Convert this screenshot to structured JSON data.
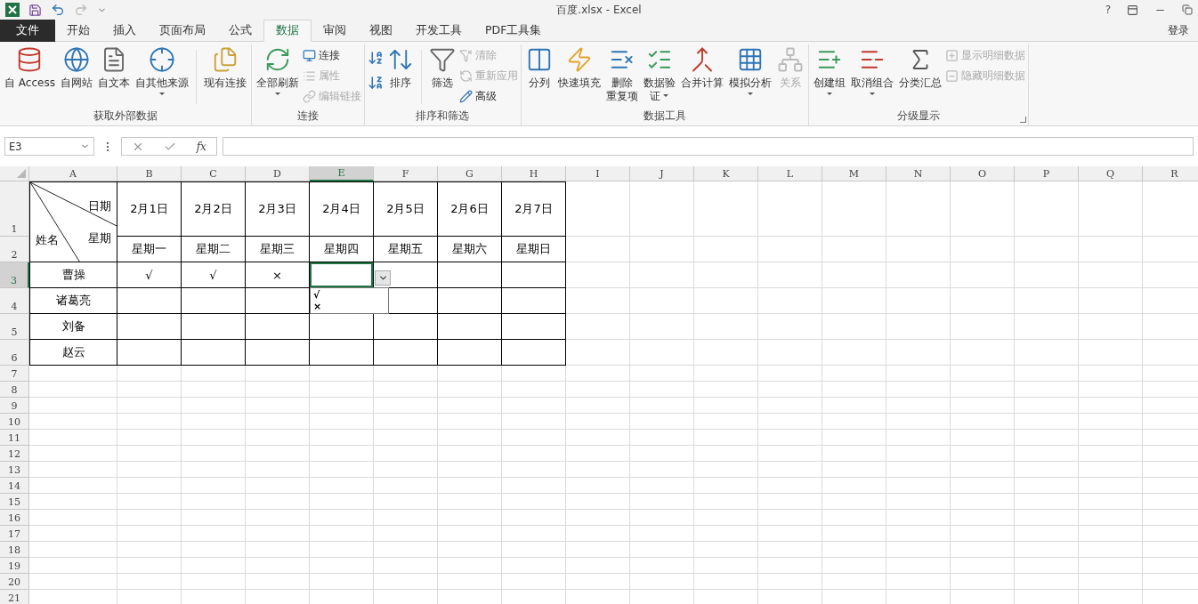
{
  "window": {
    "title": "百度.xlsx - Excel",
    "help": "?"
  },
  "tabs": [
    {
      "label": "文件",
      "kind": "file",
      "selected": false
    },
    {
      "label": "开始",
      "kind": "tab",
      "selected": false
    },
    {
      "label": "插入",
      "kind": "tab",
      "selected": false
    },
    {
      "label": "页面布局",
      "kind": "tab",
      "selected": false
    },
    {
      "label": "公式",
      "kind": "tab",
      "selected": false
    },
    {
      "label": "数据",
      "kind": "tab",
      "selected": true
    },
    {
      "label": "审阅",
      "kind": "tab",
      "selected": false
    },
    {
      "label": "视图",
      "kind": "tab",
      "selected": false
    },
    {
      "label": "开发工具",
      "kind": "tab",
      "selected": false
    },
    {
      "label": "PDF工具集",
      "kind": "tab",
      "selected": false
    }
  ],
  "sign_in": "登录",
  "ribbon": {
    "groups": [
      {
        "label": "获取外部数据",
        "items": [
          {
            "kind": "large",
            "label": "自 Access",
            "disabled": false,
            "dropdown": false
          },
          {
            "kind": "large",
            "label": "自网站",
            "disabled": false,
            "dropdown": false
          },
          {
            "kind": "large",
            "label": "自文本",
            "disabled": false,
            "dropdown": false
          },
          {
            "kind": "large",
            "label": "自其他来源",
            "disabled": false,
            "dropdown": true
          },
          {
            "kind": "separator"
          },
          {
            "kind": "large",
            "label": "现有连接",
            "disabled": false,
            "dropdown": false
          }
        ]
      },
      {
        "label": "连接",
        "items": [
          {
            "kind": "large",
            "label": "全部刷新",
            "disabled": false,
            "dropdown": true
          },
          {
            "kind": "stack",
            "buttons": [
              {
                "label": "连接",
                "disabled": false
              },
              {
                "label": "属性",
                "disabled": true
              },
              {
                "label": "编辑链接",
                "disabled": true
              }
            ]
          }
        ]
      },
      {
        "label": "排序和筛选",
        "items": [
          {
            "kind": "sort-pair"
          },
          {
            "kind": "large",
            "label": "排序",
            "disabled": false,
            "dropdown": false
          },
          {
            "kind": "separator"
          },
          {
            "kind": "large",
            "label": "筛选",
            "disabled": false,
            "dropdown": false
          },
          {
            "kind": "stack",
            "buttons": [
              {
                "label": "清除",
                "disabled": true
              },
              {
                "label": "重新应用",
                "disabled": true
              },
              {
                "label": "高级",
                "disabled": false
              }
            ]
          }
        ]
      },
      {
        "label": "数据工具",
        "items": [
          {
            "kind": "large",
            "label": "分列",
            "disabled": false,
            "dropdown": false
          },
          {
            "kind": "large",
            "label": "快速填充",
            "disabled": false,
            "dropdown": false
          },
          {
            "kind": "large",
            "label_lines": [
              "删除",
              "重复项"
            ],
            "disabled": false,
            "dropdown": false
          },
          {
            "kind": "large",
            "label_lines": [
              "数据验",
              "证"
            ],
            "disabled": false,
            "dropdown": true
          },
          {
            "kind": "large",
            "label": "合并计算",
            "disabled": false,
            "dropdown": false
          },
          {
            "kind": "large",
            "label": "模拟分析",
            "disabled": false,
            "dropdown": true
          },
          {
            "kind": "large",
            "label": "关系",
            "disabled": true,
            "dropdown": false
          }
        ]
      },
      {
        "label": "分级显示",
        "launcher": true,
        "items": [
          {
            "kind": "large",
            "label": "创建组",
            "disabled": false,
            "dropdown": true
          },
          {
            "kind": "large",
            "label": "取消组合",
            "disabled": false,
            "dropdown": true
          },
          {
            "kind": "large",
            "label": "分类汇总",
            "disabled": false,
            "dropdown": false
          },
          {
            "kind": "stack",
            "buttons": [
              {
                "label": "显示明细数据",
                "disabled": true
              },
              {
                "label": "隐藏明细数据",
                "disabled": true
              }
            ]
          }
        ]
      }
    ]
  },
  "formula_bar": {
    "name_box": "E3",
    "function_button": "fx"
  },
  "sheet": {
    "columns": [
      {
        "label": "A",
        "selected": false
      },
      {
        "label": "B",
        "selected": false
      },
      {
        "label": "C",
        "selected": false
      },
      {
        "label": "D",
        "selected": false
      },
      {
        "label": "E",
        "selected": true
      },
      {
        "label": "F",
        "selected": false
      },
      {
        "label": "G",
        "selected": false
      },
      {
        "label": "H",
        "selected": false
      },
      {
        "label": "I",
        "selected": false
      },
      {
        "label": "J",
        "selected": false
      },
      {
        "label": "K",
        "selected": false
      },
      {
        "label": "L",
        "selected": false
      },
      {
        "label": "M",
        "selected": false
      },
      {
        "label": "N",
        "selected": false
      },
      {
        "label": "O",
        "selected": false
      },
      {
        "label": "P",
        "selected": false
      },
      {
        "label": "Q",
        "selected": false
      },
      {
        "label": "R",
        "selected": false
      }
    ],
    "rows": [
      {
        "number": "1",
        "selected": false,
        "bordered": true,
        "cells": [
          {
            "kind": "diagonal-header",
            "top_right": "日期",
            "bottom_right": "星期",
            "bottom_left": "姓名"
          },
          "2月1日",
          "2月2日",
          "2月3日",
          "2月4日",
          "2月5日",
          "2月6日",
          "2月7日"
        ]
      },
      {
        "number": "2",
        "selected": false,
        "bordered": true,
        "cells": [
          "",
          "星期一",
          "星期二",
          "星期三",
          "星期四",
          "星期五",
          "星期六",
          "星期日"
        ]
      },
      {
        "number": "3",
        "selected": true,
        "bordered": true,
        "cells": [
          "曹操",
          "√",
          "√",
          "×",
          {
            "validation_list": {
              "open": true,
              "options": [
                "√",
                "×"
              ]
            }
          }
        ]
      },
      {
        "number": "4",
        "selected": false,
        "bordered": true,
        "cells": [
          "诸葛亮"
        ]
      },
      {
        "number": "5",
        "selected": false,
        "bordered": true,
        "cells": [
          "刘备"
        ]
      },
      {
        "number": "6",
        "selected": false,
        "bordered": true,
        "cells": [
          "赵云"
        ]
      },
      {
        "number": "7",
        "selected": false,
        "bordered": false,
        "cells": []
      },
      {
        "number": "8",
        "selected": false,
        "bordered": false,
        "cells": []
      },
      {
        "number": "9",
        "selected": false,
        "bordered": false,
        "cells": []
      },
      {
        "number": "10",
        "selected": false,
        "bordered": false,
        "cells": []
      },
      {
        "number": "11",
        "selected": false,
        "bordered": false,
        "cells": []
      },
      {
        "number": "12",
        "selected": false,
        "bordered": false,
        "cells": []
      },
      {
        "number": "13",
        "selected": false,
        "bordered": false,
        "cells": []
      },
      {
        "number": "14",
        "selected": false,
        "bordered": false,
        "cells": []
      },
      {
        "number": "15",
        "selected": false,
        "bordered": false,
        "cells": []
      },
      {
        "number": "16",
        "selected": false,
        "bordered": false,
        "cells": []
      },
      {
        "number": "17",
        "selected": false,
        "bordered": false,
        "cells": []
      },
      {
        "number": "18",
        "selected": false,
        "bordered": false,
        "cells": []
      },
      {
        "number": "19",
        "selected": false,
        "bordered": false,
        "cells": []
      },
      {
        "number": "20",
        "selected": false,
        "bordered": false,
        "cells": []
      },
      {
        "number": "21",
        "selected": false,
        "bordered": false,
        "cells": []
      }
    ]
  }
}
